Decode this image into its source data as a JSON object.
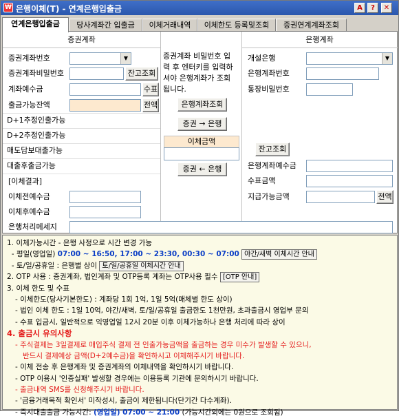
{
  "window": {
    "title": "은행이체(T) - 연계은행입출금",
    "buttons": {
      "a": "A",
      "help": "?",
      "close": "✕"
    }
  },
  "tabs": [
    "연계은행입출금",
    "당사계좌간 입출금",
    "이체거래내역",
    "이체한도 등록및조회",
    "증권연계계좌조회"
  ],
  "securities": {
    "header": "증권계좌",
    "account_no_label": "증권계좌번호",
    "password_label": "증권계좌비밀번호",
    "balance_btn": "잔고조회",
    "deposit_label": "계좌예수금",
    "fee_btn": "수표",
    "withdrawable_label": "출금가능잔액",
    "detail_btn": "전액",
    "d1_label": "D+1추정인출가능",
    "d2_label": "D+2추정인출가능",
    "sell_label": "매도담보대출가능",
    "loan_label": "대출후출금가능",
    "result_label": "[이체결과]",
    "before_label": "이체전예수금",
    "after_label": "이체후예수금",
    "bank_msg_label": "은행처리메세지"
  },
  "middle": {
    "guide": "증권계좌 비밀번호 입력 후 엔터키를 입력하셔야 은행계좌가 조회됩니다.",
    "bank_query_btn": "은행계좌조회",
    "to_bank_btn": "증권 → 은행",
    "amount_label": "이체금액",
    "to_sec_btn": "증권 ← 은행"
  },
  "bank": {
    "header": "은행계좌",
    "bank_label": "개설은행",
    "account_label": "은행계좌번호",
    "password_label": "통장비밀번호",
    "balance_btn": "잔고조회",
    "deposit_label": "은행계좌예수금",
    "check_label": "수표금액",
    "payable_label": "지급가능금액",
    "detail_btn": "전액"
  },
  "info": {
    "l1": "1. 이체가능시간 - 은행 사정으로 시간 변경 가능",
    "l2a": "- 평일(영업일) ",
    "l2b": "07:00 ~ 16:50, 17:00 ~ 23:30, 00:30 ~ 07:00",
    "l2btn": "야간/새벽 이체시간 안내",
    "l3a": "- 토/일/공휴일 : 은행별 상이",
    "l3btn": "토/일/공휴일 이체시간 안내",
    "l4a": "2. OTP 사용 : 증권계좌, 법인계좌 및 OTP등록 계좌는 OTP사용 필수",
    "l4btn": "[OTP 안내]",
    "l5": "3. 이체 한도 및 수표",
    "l6": "- 이체한도(당사기본한도) : 계좌당 1회 1억, 1일 5억(매체별 한도 상이)",
    "l7": "- 법인 이체 한도 : 1일 10억, 야간/새벽, 토/일/공휴일 출금한도 1천만원, 초과출금시 영업부 문의",
    "l8": "- 수표 입금시, 일반적으로 익영업일 12시 20분 이후 이체가능하나 은행 처리에 따라 상이",
    "l9": "4. 출금시 유의사항",
    "l10": "- 주식결제는 3일결제로 매입주식 결제 전 인출가능금액을 출금하는 경우 미수가 발생할 수 있으니,",
    "l11": "반드시 결제예상 금액(D+2예수금)을 확인하시고 이체해주시기 바랍니다.",
    "l12": "- 이체 전송 후 은행계좌 및 증권계좌의 이체내역을 확인하시기 바랍니다.",
    "l13": "- OTP 이용시 '인증실패' 발생할 경우에는 이용등록 기관에 문의하시기 바랍니다.",
    "l14": "- 출금내역 SMS를 신청해주시기 바랍니다.",
    "l15": "- '금융거래목적 확인서' 미작성시, 출금이 제한됩니다(단기간 다수계좌).",
    "l16a": "- 즉시대출출금 가능시간: ",
    "l16b": "(영업일) 07:00 ~ 21:00",
    "l16c": " (가능시간외에는 0원으로 조회됨)"
  }
}
